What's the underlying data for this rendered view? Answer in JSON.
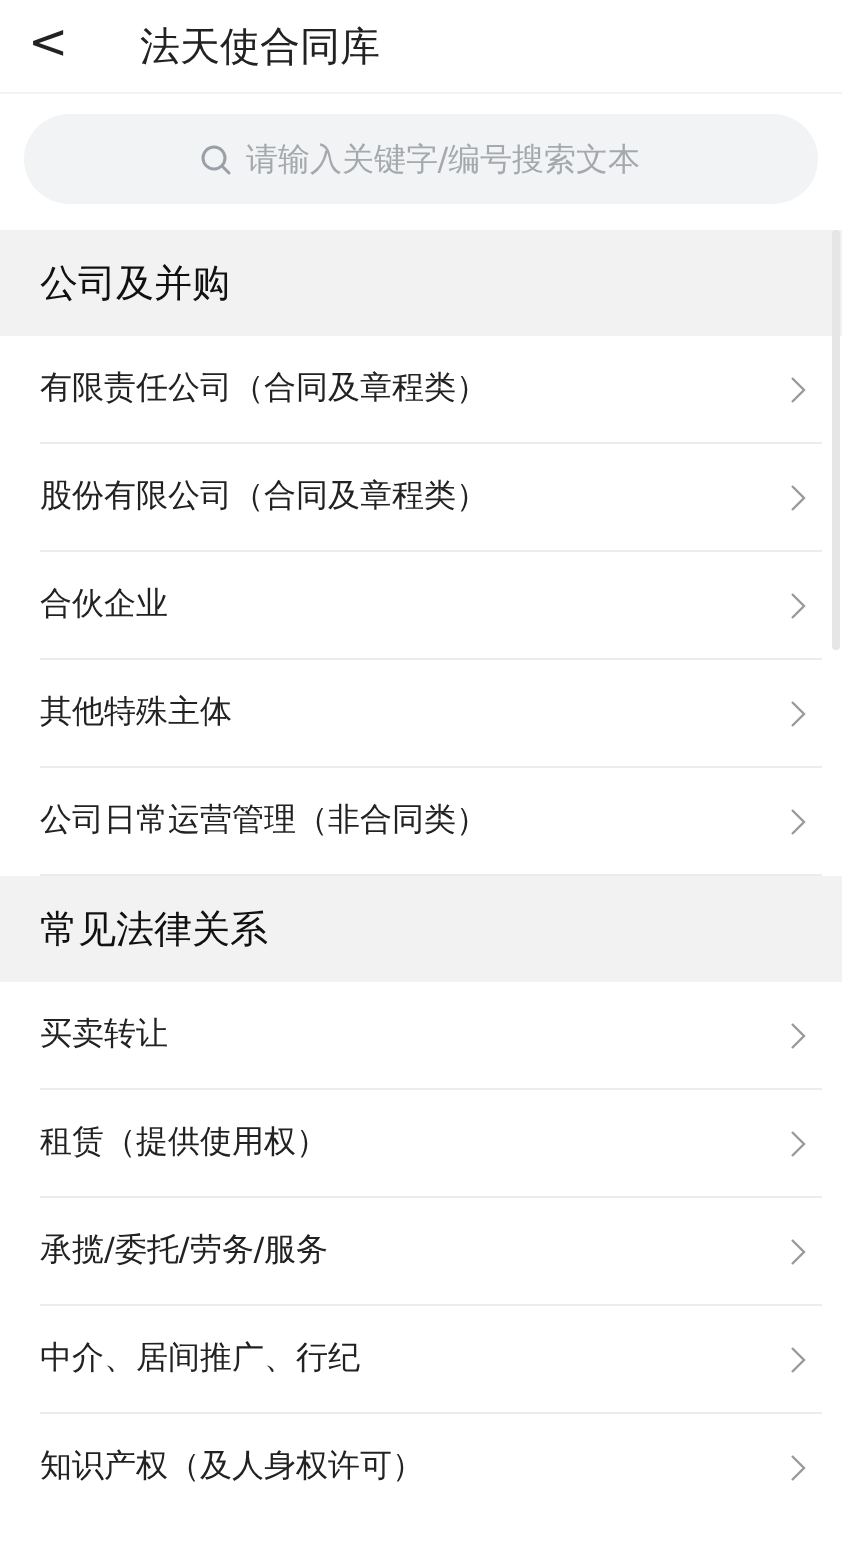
{
  "header": {
    "back": "<",
    "title": "法天使合同库"
  },
  "search": {
    "placeholder": "请输入关键字/编号搜索文本"
  },
  "sections": [
    {
      "title": "公司及并购",
      "items": [
        "有限责任公司（合同及章程类）",
        "股份有限公司（合同及章程类）",
        "合伙企业",
        "其他特殊主体",
        "公司日常运营管理（非合同类）"
      ]
    },
    {
      "title": "常见法律关系",
      "items": [
        "买卖转让",
        "租赁（提供使用权）",
        "承揽/委托/劳务/服务",
        "中介、居间推广、行纪",
        "知识产权（及人身权许可）"
      ]
    }
  ]
}
